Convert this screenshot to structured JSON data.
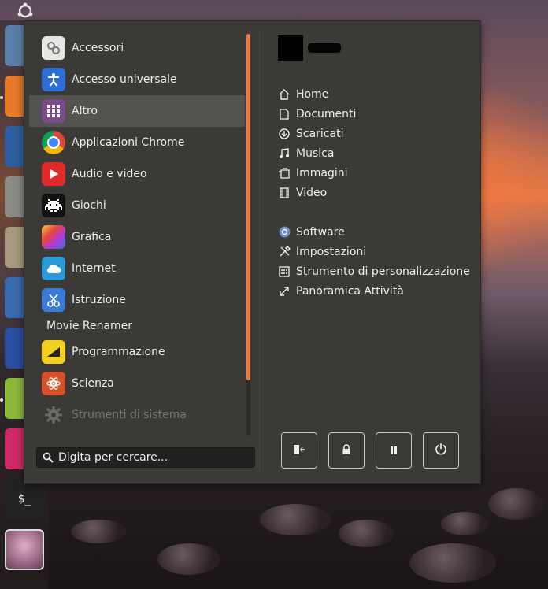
{
  "menu": {
    "categories": [
      {
        "label": "Accessori",
        "icon": "accessories-icon"
      },
      {
        "label": "Accesso universale",
        "icon": "accessibility-icon"
      },
      {
        "label": "Altro",
        "icon": "other-apps-icon"
      },
      {
        "label": "Applicazioni Chrome",
        "icon": "chrome-icon"
      },
      {
        "label": "Audio e video",
        "icon": "multimedia-icon"
      },
      {
        "label": "Giochi",
        "icon": "games-icon"
      },
      {
        "label": "Grafica",
        "icon": "graphics-icon"
      },
      {
        "label": "Internet",
        "icon": "internet-icon"
      },
      {
        "label": "Istruzione",
        "icon": "education-icon"
      },
      {
        "label": "Movie Renamer",
        "icon": ""
      },
      {
        "label": "Programmazione",
        "icon": "development-icon"
      },
      {
        "label": "Scienza",
        "icon": "science-icon"
      },
      {
        "label": "Strumenti di sistema",
        "icon": "system-tools-icon"
      }
    ],
    "selected": "Altro",
    "search_placeholder": "Digita per cercare...",
    "places": [
      {
        "label": "Home",
        "icon": "home-icon"
      },
      {
        "label": "Documenti",
        "icon": "document-icon"
      },
      {
        "label": "Scaricati",
        "icon": "download-icon"
      },
      {
        "label": "Musica",
        "icon": "music-icon"
      },
      {
        "label": "Immagini",
        "icon": "pictures-icon"
      },
      {
        "label": "Video",
        "icon": "video-icon"
      }
    ],
    "system": [
      {
        "label": "Software",
        "icon": "software-icon"
      },
      {
        "label": "Impostazioni",
        "icon": "settings-icon"
      },
      {
        "label": "Strumento di personalizzazione",
        "icon": "tweak-tool-icon"
      },
      {
        "label": "Panoramica Attività",
        "icon": "activities-icon"
      }
    ],
    "session_buttons": [
      "logout-icon",
      "lock-icon",
      "suspend-icon",
      "power-icon"
    ]
  },
  "colors": {
    "accent": "#f07746",
    "menu_bg": "#3b3a36",
    "selected_bg": "#545350",
    "text": "#eeeeec"
  }
}
